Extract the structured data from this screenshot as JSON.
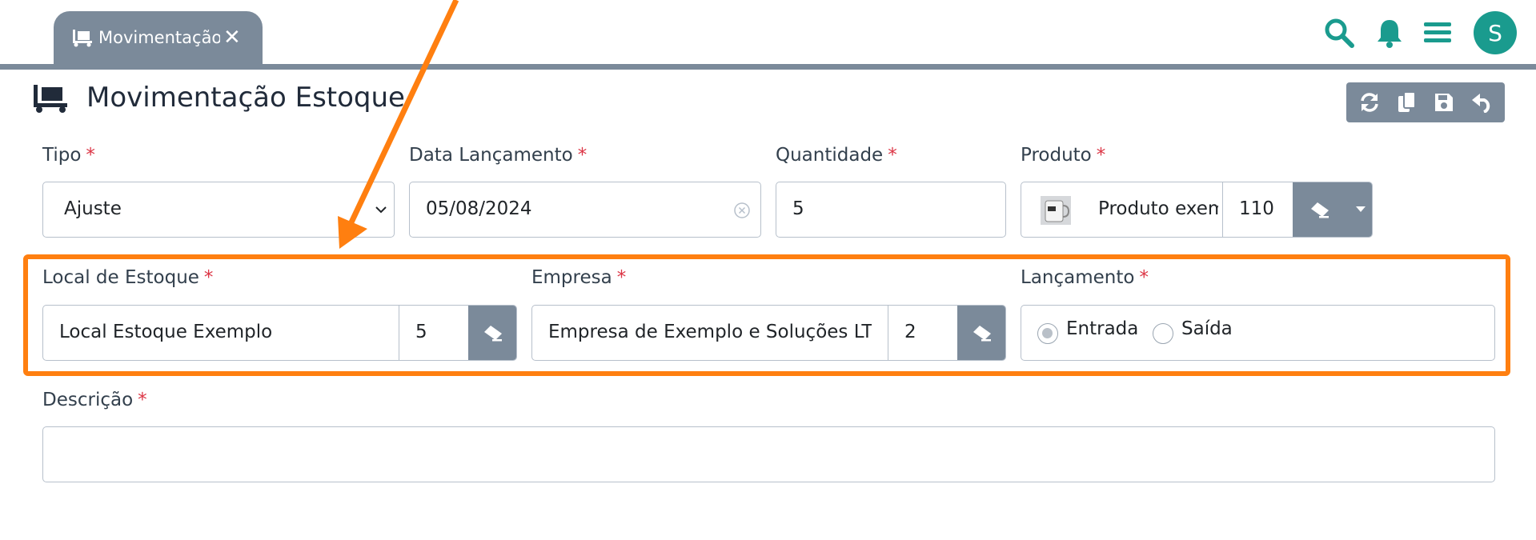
{
  "tab": {
    "label": "Movimentação de Estoque"
  },
  "page": {
    "title": "Movimentação Estoque"
  },
  "user": {
    "initial": "S"
  },
  "form": {
    "tipo": {
      "label": "Tipo",
      "value": "Ajuste"
    },
    "data_lancamento": {
      "label": "Data Lançamento",
      "value": "05/08/2024"
    },
    "quantidade": {
      "label": "Quantidade",
      "value": "5"
    },
    "produto": {
      "label": "Produto",
      "name": "Produto exemplo",
      "code": "110"
    },
    "local_estoque": {
      "label": "Local de Estoque",
      "name": "Local Estoque Exemplo",
      "code": "5"
    },
    "empresa": {
      "label": "Empresa",
      "name": "Empresa de Exemplo e Soluções LTDA",
      "code": "2"
    },
    "lancamento": {
      "label": "Lançamento",
      "options": [
        "Entrada",
        "Saída"
      ],
      "selected": "Entrada"
    },
    "descricao": {
      "label": "Descrição",
      "value": ""
    },
    "required_mark": "*"
  },
  "colors": {
    "accent": "#1a9b8e",
    "grey": "#7b8a9a",
    "highlight": "#ff7f10",
    "required": "#dc3545"
  }
}
